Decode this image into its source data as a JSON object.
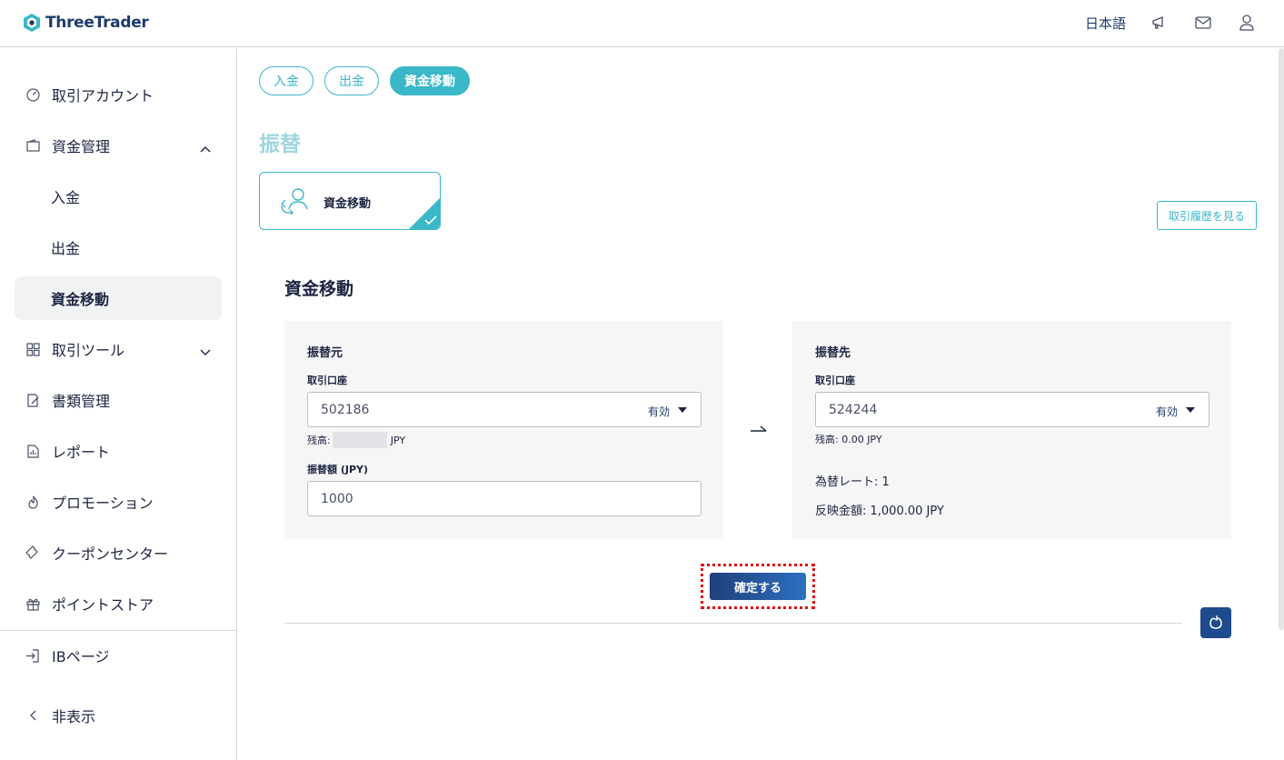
{
  "header": {
    "logo_text": "ThreeTrader",
    "language": "日本語"
  },
  "sidebar": {
    "items": [
      {
        "label": "取引アカウント",
        "icon": "speedometer-icon"
      },
      {
        "label": "資金管理",
        "icon": "wallet-icon",
        "expanded": true
      },
      {
        "label": "入金"
      },
      {
        "label": "出金"
      },
      {
        "label": "資金移動",
        "active": true
      },
      {
        "label": "取引ツール",
        "icon": "tools-icon",
        "expanded": false
      },
      {
        "label": "書類管理",
        "icon": "document-edit-icon"
      },
      {
        "label": "レポート",
        "icon": "report-icon"
      },
      {
        "label": "プロモーション",
        "icon": "flame-icon"
      },
      {
        "label": "クーポンセンター",
        "icon": "ticket-icon"
      },
      {
        "label": "ポイントストア",
        "icon": "gift-icon"
      }
    ],
    "ib_page": "IBページ",
    "hide": "非表示"
  },
  "tabs": [
    "入金",
    "出金",
    "資金移動"
  ],
  "page_title": "振替",
  "transfer_type": {
    "label": "資金移動"
  },
  "history_button": "取引履歴を見る",
  "section_title": "資金移動",
  "from": {
    "title": "振替元",
    "account_label": "取引口座",
    "account": "502186",
    "status": "有効",
    "balance_prefix": "残高:",
    "balance_currency": "JPY",
    "amount_label": "振替額 (JPY)",
    "amount": "1000"
  },
  "to": {
    "title": "振替先",
    "account_label": "取引口座",
    "account": "524244",
    "status": "有効",
    "balance": "残高: 0.00 JPY",
    "rate": "為替レート: 1",
    "reflected": "反映金額: 1,000.00 JPY"
  },
  "confirm_button": "確定する",
  "colors": {
    "accent": "#3ab7c8",
    "primary": "#1d4b8c",
    "highlight": "#e01010"
  }
}
